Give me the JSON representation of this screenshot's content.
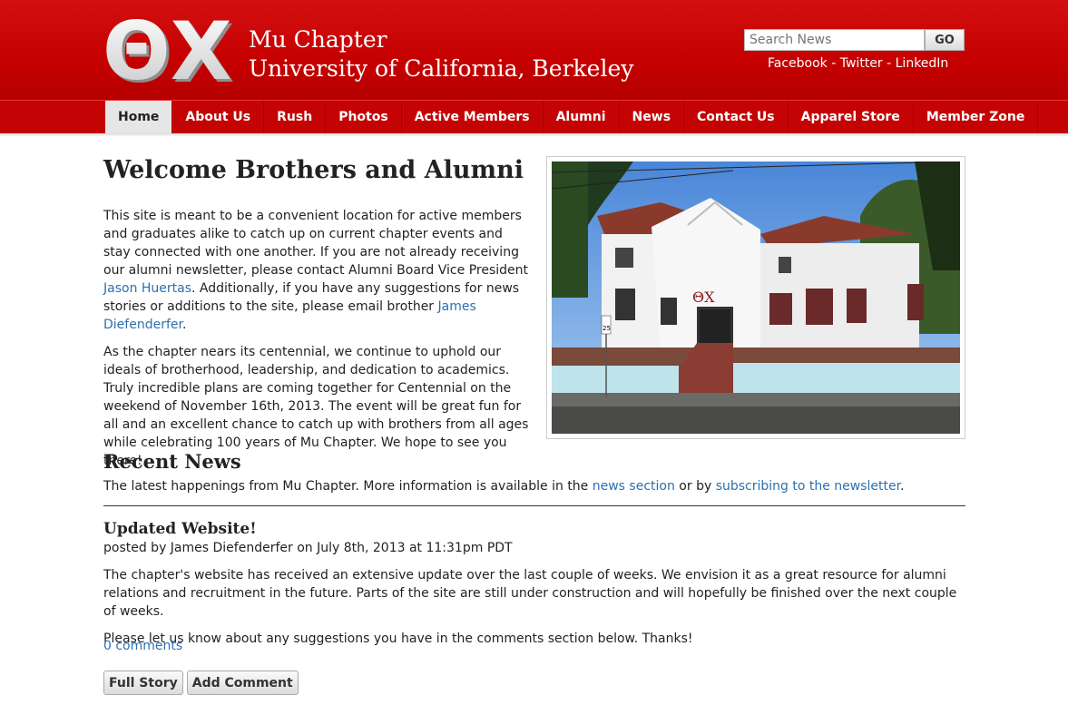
{
  "header": {
    "logo_text": "ΘΧ",
    "chapter_name": "Mu Chapter",
    "university": "University of California, Berkeley",
    "search_placeholder": "Search News",
    "search_button": "GO",
    "social": [
      "Facebook",
      "Twitter",
      "LinkedIn"
    ],
    "social_sep": " - "
  },
  "nav": [
    {
      "label": "Home",
      "active": true
    },
    {
      "label": "About Us"
    },
    {
      "label": "Rush"
    },
    {
      "label": "Photos"
    },
    {
      "label": "Active Members"
    },
    {
      "label": "Alumni"
    },
    {
      "label": "News"
    },
    {
      "label": "Contact Us"
    },
    {
      "label": "Apparel Store"
    },
    {
      "label": "Member Zone"
    }
  ],
  "welcome": {
    "title": "Welcome Brothers and Alumni",
    "p1_a": "This site is meant to be a convenient location for active members and graduates alike to catch up on current chapter events and stay connected with one another. If you are not already receiving our alumni newsletter, please contact Alumni Board Vice President ",
    "p1_link1": "Jason Huertas",
    "p1_b": ". Additionally, if you have any suggestions for news stories or additions to the site, please email brother ",
    "p1_link2": "James Diefenderfer",
    "p1_c": ".",
    "p2": "As the chapter nears its centennial, we continue to uphold our ideals of brotherhood, leadership, and dedication to academics. Truly incredible plans are coming together for Centennial on the weekend of November 16th, 2013. The event will be great fun for all and an excellent chance to catch up with brothers from all ages while celebrating 100 years of Mu Chapter. We hope to see you there!",
    "house_letters": "ΘΧ",
    "sign_number": "25"
  },
  "recent": {
    "title": "Recent News",
    "desc_a": "The latest happenings from Mu Chapter. More information is available in the ",
    "link1": "news section",
    "desc_b": " or by ",
    "link2": "subscribing to the newsletter",
    "desc_c": "."
  },
  "post": {
    "title": "Updated Website!",
    "meta": "posted by James Diefenderfer on July 8th, 2013 at 11:31pm PDT",
    "body1": "The chapter's website has received an extensive update over the last couple of weeks. We envision it as a great resource for alumni relations and recruitment in the future. Parts of the site are still under construction and will hopefully be finished over the next couple of weeks.",
    "body2": "Please let us know about any suggestions you have in the comments section below. Thanks!",
    "comments": "0 comments",
    "full_story": "Full Story",
    "add_comment": "Add Comment"
  },
  "colors": {
    "brand_red": "#c40404",
    "link_blue": "#2d6fb0"
  }
}
